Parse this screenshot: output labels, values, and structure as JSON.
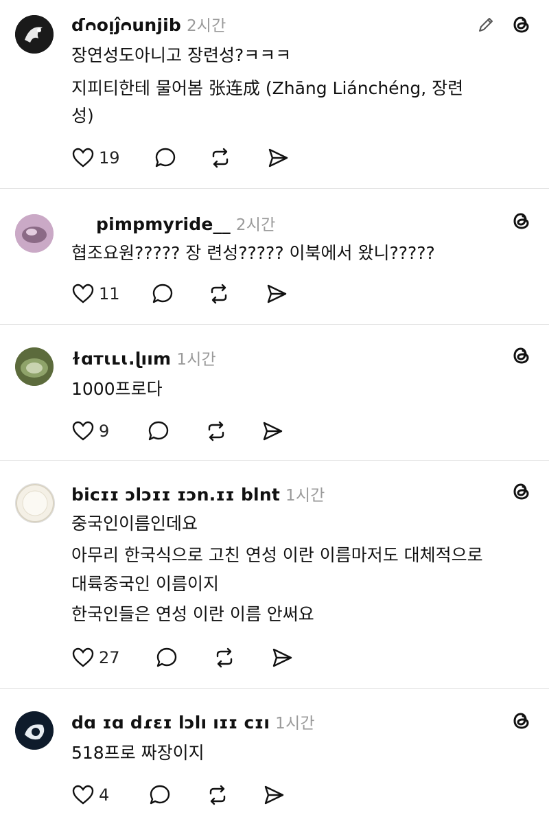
{
  "posts": [
    {
      "username": "ɗᴒᴏᴉĵᴒunjib",
      "time": "2시간",
      "lines": [
        "장연성도아니고 장련성?ㅋㅋㅋ",
        "지피티한테 물어봄 张连成 (Zhāng Liánchéng, 장련",
        "성)"
      ],
      "likes": "19",
      "has_edit": true
    },
    {
      "username": "pimpmyride__",
      "time": "2시간",
      "lines": [
        "협조요원????? 장 련성????? 이북에서 왔니?????"
      ],
      "likes": "11"
    },
    {
      "username": "ɫɑᴛɩʟɩ.ɭıım",
      "time": "1시간",
      "lines": [
        "1000프로다"
      ],
      "likes": "9"
    },
    {
      "username": "bicɪɪ ɔlɔɪɪ ɪɔn.ɪɪ blnt",
      "time": "1시간",
      "lines": [
        "중국인이름인데요",
        "아무리 한국식으로 고친 연성 이란 이름마저도 대체적으로",
        "대륙중국인 이름이지",
        "한국인들은 연성 이란 이름 안써요"
      ],
      "likes": "27"
    },
    {
      "username": "dɑ ɪɑ dɾɛɪ lɔlı ıɪɪ cɪı",
      "time": "1시간",
      "lines": [
        "518프로 짜장이지"
      ],
      "likes": "4"
    }
  ],
  "icons": {
    "like": "heart-icon",
    "reply": "comment-icon",
    "repost": "repost-icon",
    "share": "share-icon",
    "app": "threads-logo-icon",
    "edit": "pencil-icon"
  },
  "colors": {
    "time": "#9a9a9a",
    "divider": "#e3e3e3",
    "text": "#111111"
  }
}
